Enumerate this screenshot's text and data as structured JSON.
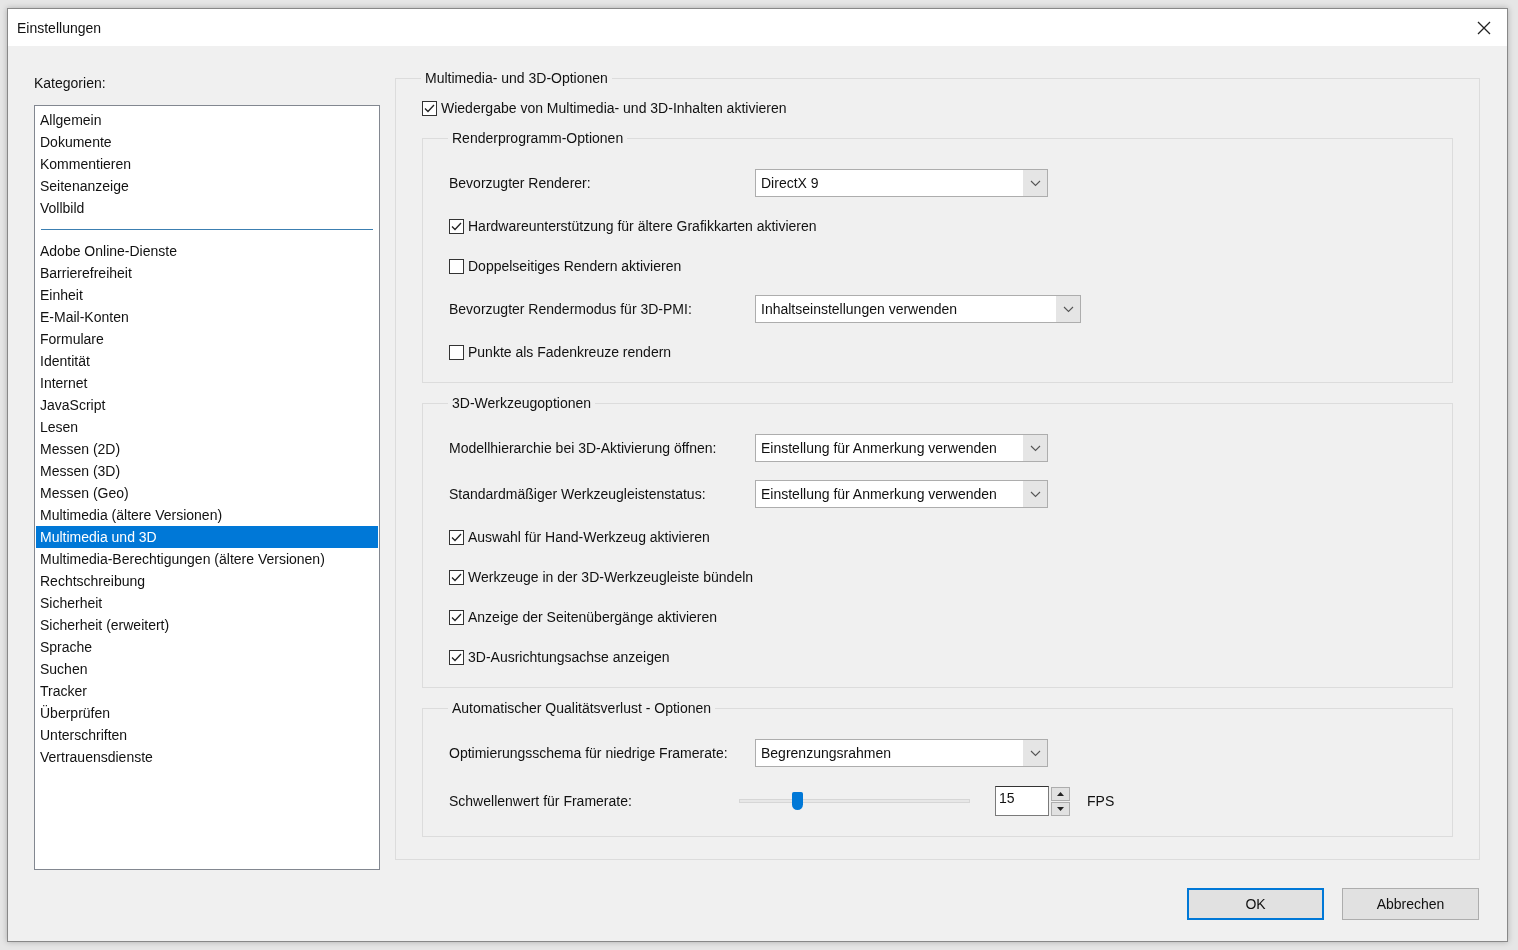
{
  "window": {
    "title": "Einstellungen"
  },
  "categories": {
    "label": "Kategorien:",
    "groups": [
      [
        {
          "label": "Allgemein",
          "selected": false
        },
        {
          "label": "Dokumente",
          "selected": false
        },
        {
          "label": "Kommentieren",
          "selected": false
        },
        {
          "label": "Seitenanzeige",
          "selected": false
        },
        {
          "label": "Vollbild",
          "selected": false
        }
      ],
      [
        {
          "label": "Adobe Online-Dienste",
          "selected": false
        },
        {
          "label": "Barrierefreiheit",
          "selected": false
        },
        {
          "label": "Einheit",
          "selected": false
        },
        {
          "label": "E-Mail-Konten",
          "selected": false
        },
        {
          "label": "Formulare",
          "selected": false
        },
        {
          "label": "Identität",
          "selected": false
        },
        {
          "label": "Internet",
          "selected": false
        },
        {
          "label": "JavaScript",
          "selected": false
        },
        {
          "label": "Lesen",
          "selected": false
        },
        {
          "label": "Messen (2D)",
          "selected": false
        },
        {
          "label": "Messen (3D)",
          "selected": false
        },
        {
          "label": "Messen (Geo)",
          "selected": false
        },
        {
          "label": "Multimedia (ältere Versionen)",
          "selected": false
        },
        {
          "label": "Multimedia und 3D",
          "selected": true
        },
        {
          "label": "Multimedia-Berechtigungen (ältere Versionen)",
          "selected": false
        },
        {
          "label": "Rechtschreibung",
          "selected": false
        },
        {
          "label": "Sicherheit",
          "selected": false
        },
        {
          "label": "Sicherheit (erweitert)",
          "selected": false
        },
        {
          "label": "Sprache",
          "selected": false
        },
        {
          "label": "Suchen",
          "selected": false
        },
        {
          "label": "Tracker",
          "selected": false
        },
        {
          "label": "Überprüfen",
          "selected": false
        },
        {
          "label": "Unterschriften",
          "selected": false
        },
        {
          "label": "Vertrauensdienste",
          "selected": false
        }
      ]
    ]
  },
  "section": {
    "title": "Multimedia- und 3D-Optionen",
    "enable": {
      "label": "Wiedergabe von Multimedia- und 3D-Inhalten aktivieren",
      "checked": true
    },
    "groups": [
      {
        "title": "Renderprogramm-Optionen",
        "rows": [
          {
            "kind": "dropdown",
            "label": "Bevorzugter Renderer:",
            "value": "DirectX 9"
          },
          {
            "kind": "checkbox",
            "label": "Hardwareunterstützung für ältere Grafikkarten aktivieren",
            "checked": true
          },
          {
            "kind": "checkbox",
            "label": "Doppelseitiges Rendern aktivieren",
            "checked": false
          },
          {
            "kind": "dropdown",
            "label": "Bevorzugter Rendermodus für 3D-PMI:",
            "value": "Inhaltseinstellungen verwenden"
          },
          {
            "kind": "checkbox",
            "label": "Punkte als Fadenkreuze rendern",
            "checked": false
          }
        ]
      },
      {
        "title": "3D-Werkzeugoptionen",
        "rows": [
          {
            "kind": "dropdown",
            "label": "Modellhierarchie bei 3D-Aktivierung öffnen:",
            "value": "Einstellung für Anmerkung verwenden"
          },
          {
            "kind": "dropdown",
            "label": "Standardmäßiger Werkzeugleistenstatus:",
            "value": "Einstellung für Anmerkung verwenden"
          },
          {
            "kind": "checkbox",
            "label": "Auswahl für Hand-Werkzeug aktivieren",
            "checked": true
          },
          {
            "kind": "checkbox",
            "label": "Werkzeuge in der 3D-Werkzeugleiste bündeln",
            "checked": true
          },
          {
            "kind": "checkbox",
            "label": "Anzeige der Seitenübergänge aktivieren",
            "checked": true
          },
          {
            "kind": "checkbox",
            "label": "3D-Ausrichtungsachse anzeigen",
            "checked": true
          }
        ]
      },
      {
        "title": "Automatischer Qualitätsverlust - Optionen",
        "rows": [
          {
            "kind": "dropdown",
            "label": "Optimierungsschema für niedrige Framerate:",
            "value": "Begrenzungsrahmen"
          },
          {
            "kind": "slider",
            "label": "Schwellenwert für Framerate:",
            "level": 0.25,
            "value": "15",
            "unit": "FPS"
          }
        ]
      }
    ]
  },
  "buttons": [
    {
      "label": "OK",
      "default": true
    },
    {
      "label": "Abbrechen",
      "default": false
    }
  ]
}
